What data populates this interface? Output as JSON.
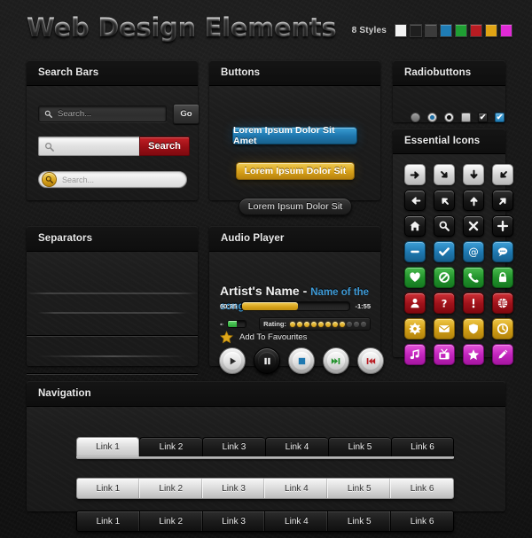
{
  "header": {
    "title": "Web Design Elements",
    "styles_label": "8 Styles",
    "swatch_colors": [
      "#f2f2f2",
      "#1f1f1f",
      "#3b3b3b",
      "#1f7cb4",
      "#1f9e33",
      "#b81c22",
      "#e0a414",
      "#e02ad6"
    ]
  },
  "panels": {
    "search_bars": {
      "title": "Search Bars"
    },
    "buttons": {
      "title": "Buttons"
    },
    "radiobuttons": {
      "title": "Radiobuttons"
    },
    "essential_icons": {
      "title": "Essential Icons"
    },
    "separators": {
      "title": "Separators"
    },
    "audio_player": {
      "title": "Audio Player"
    },
    "navigation": {
      "title": "Navigation"
    }
  },
  "search": {
    "dark": {
      "placeholder": "Search...",
      "button_label": "Go"
    },
    "light": {
      "placeholder": "",
      "button_label": "Search"
    },
    "rounded": {
      "placeholder": "Search..."
    }
  },
  "buttons": {
    "blue_label": "Lorem Ipsum Dolor Sit Amet",
    "gold_label": "Lorem Ipsum Dolor Sit",
    "dark_label": "Lorem Ipsum Dolor Sit"
  },
  "radio": {
    "items": [
      {
        "name": "radio-unselected",
        "type": "radio",
        "state": "off"
      },
      {
        "name": "radio-selected-blue",
        "type": "radio",
        "state": "blue"
      },
      {
        "name": "radio-selected-black",
        "type": "radio",
        "state": "black"
      },
      {
        "name": "checkbox-unchecked",
        "type": "checkbox",
        "state": "off",
        "glyph": ""
      },
      {
        "name": "checkbox-checked-dark",
        "type": "checkbox",
        "state": "dark",
        "glyph": "✔"
      },
      {
        "name": "checkbox-checked-blue",
        "type": "checkbox",
        "state": "blue",
        "glyph": "✔"
      }
    ]
  },
  "icons": {
    "list": [
      {
        "name": "arrow-right-icon",
        "color": "white",
        "glyph": "arrow-right"
      },
      {
        "name": "arrow-down-right-icon",
        "color": "white",
        "glyph": "arrow-down-right"
      },
      {
        "name": "arrow-down-icon",
        "color": "white",
        "glyph": "arrow-down"
      },
      {
        "name": "arrow-down-left-icon",
        "color": "white",
        "glyph": "arrow-down-left"
      },
      {
        "name": "arrow-left-icon",
        "color": "black",
        "glyph": "arrow-left"
      },
      {
        "name": "arrow-up-left-icon",
        "color": "black",
        "glyph": "arrow-up-left"
      },
      {
        "name": "arrow-up-icon",
        "color": "black",
        "glyph": "arrow-up"
      },
      {
        "name": "arrow-up-right-icon",
        "color": "black",
        "glyph": "arrow-up-right"
      },
      {
        "name": "home-icon",
        "color": "black",
        "glyph": "home"
      },
      {
        "name": "search-icon",
        "color": "black",
        "glyph": "search"
      },
      {
        "name": "close-icon",
        "color": "black",
        "glyph": "close"
      },
      {
        "name": "plus-icon",
        "color": "black",
        "glyph": "plus"
      },
      {
        "name": "minus-icon",
        "color": "blue",
        "glyph": "minus"
      },
      {
        "name": "check-icon",
        "color": "blue",
        "glyph": "check"
      },
      {
        "name": "at-icon",
        "color": "blue",
        "glyph": "at"
      },
      {
        "name": "chat-bubble-icon",
        "color": "blue",
        "glyph": "chat"
      },
      {
        "name": "heart-icon",
        "color": "green",
        "glyph": "heart"
      },
      {
        "name": "forbidden-icon",
        "color": "green",
        "glyph": "forbidden"
      },
      {
        "name": "phone-icon",
        "color": "green",
        "glyph": "phone"
      },
      {
        "name": "lock-icon",
        "color": "green",
        "glyph": "lock"
      },
      {
        "name": "user-icon",
        "color": "red",
        "glyph": "user"
      },
      {
        "name": "question-mark-icon",
        "color": "red",
        "glyph": "question"
      },
      {
        "name": "exclamation-mark-icon",
        "color": "red",
        "glyph": "exclamation"
      },
      {
        "name": "globe-icon",
        "color": "red",
        "glyph": "globe"
      },
      {
        "name": "gear-icon",
        "color": "gold",
        "glyph": "gear"
      },
      {
        "name": "mail-icon",
        "color": "gold",
        "glyph": "mail"
      },
      {
        "name": "shield-icon",
        "color": "gold",
        "glyph": "shield"
      },
      {
        "name": "clock-icon",
        "color": "gold",
        "glyph": "clock"
      },
      {
        "name": "music-note-icon",
        "color": "magenta",
        "glyph": "music"
      },
      {
        "name": "tv-icon",
        "color": "magenta",
        "glyph": "tv"
      },
      {
        "name": "star-icon",
        "color": "magenta",
        "glyph": "star"
      },
      {
        "name": "pencil-icon",
        "color": "magenta",
        "glyph": "pencil"
      }
    ]
  },
  "audio": {
    "artist": "Artist's Name -",
    "song": "Name of the song",
    "time_elapsed": "00:35",
    "time_remaining": "-1:55",
    "progress_percent": 52,
    "volume_percent": 48,
    "rating_label": "Rating:",
    "rating_filled": 8,
    "rating_total": 11,
    "favourites_label": "Add To Favourites",
    "controls": [
      {
        "name": "play-button",
        "glyph": "play"
      },
      {
        "name": "pause-button",
        "glyph": "pause"
      },
      {
        "name": "stop-button",
        "glyph": "stop"
      },
      {
        "name": "next-button",
        "glyph": "next"
      },
      {
        "name": "previous-button",
        "glyph": "previous"
      }
    ]
  },
  "navigation": {
    "tabs": [
      "Link 1",
      "Link 2",
      "Link 3",
      "Link 4",
      "Link 5",
      "Link 6"
    ],
    "active_tab_index": 0,
    "light_bar": [
      "Link 1",
      "Link 2",
      "Link 3",
      "Link 4",
      "Link 5",
      "Link 6"
    ],
    "dark_bar": [
      "Link 1",
      "Link 2",
      "Link 3",
      "Link 4",
      "Link 5",
      "Link 6"
    ]
  }
}
